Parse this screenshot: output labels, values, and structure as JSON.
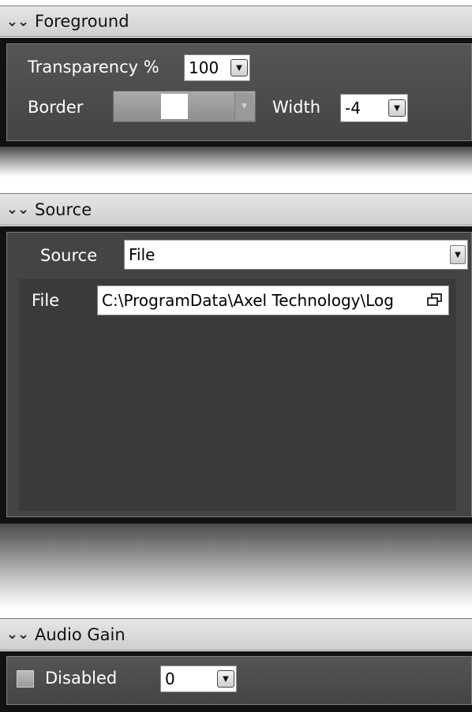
{
  "foreground": {
    "title": "Foreground",
    "transparency_label": "Transparency %",
    "transparency_value": "100",
    "border_label": "Border",
    "border_color": "#ffffff",
    "width_label": "Width",
    "width_value": "-4"
  },
  "source_section": {
    "title": "Source",
    "source_label": "Source",
    "source_value": "File",
    "file_label": "File",
    "file_value": "C:\\ProgramData\\Axel Technology\\Log"
  },
  "audio_gain": {
    "title": "Audio Gain",
    "disabled_label": "Disabled",
    "disabled_checked": false,
    "gain_value": "0"
  },
  "icons": {
    "expand": "double-chevron-down-icon",
    "dropdown": "dropdown-arrow-icon",
    "browse": "browse-icon"
  }
}
